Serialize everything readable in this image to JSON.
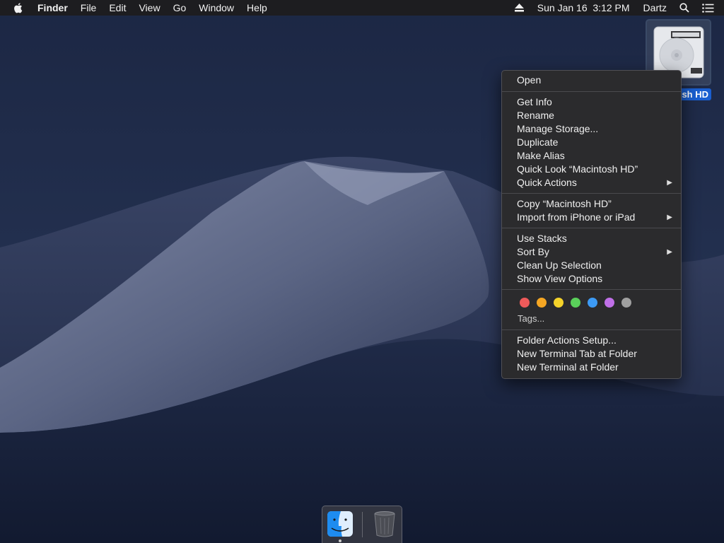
{
  "menubar": {
    "apple_icon": "apple-logo-icon",
    "app_name": "Finder",
    "menus": [
      "File",
      "Edit",
      "View",
      "Go",
      "Window",
      "Help"
    ],
    "status": {
      "eject_icon": "eject-icon",
      "clock": "Sun Jan 16  3:12 PM",
      "user": "Dartz",
      "search_icon": "spotlight-search-icon",
      "notification_icon": "notification-center-icon"
    }
  },
  "desktop": {
    "hd_icon_label": "sh HD",
    "hd_icon_name": "hard-drive-icon"
  },
  "context_menu": {
    "open": "Open",
    "group2": [
      "Get Info",
      "Rename",
      "Manage Storage...",
      "Duplicate",
      "Make Alias",
      "Quick Look “Macintosh HD”",
      "Quick Actions"
    ],
    "group3": [
      "Copy “Macintosh HD”",
      "Import from iPhone or iPad"
    ],
    "group4": [
      "Use Stacks",
      "Sort By",
      "Clean Up Selection",
      "Show View Options"
    ],
    "tags_label": "Tags...",
    "tag_colors": [
      "#ee5a5a",
      "#f5a623",
      "#f5d32a",
      "#5ad05a",
      "#3d9bf5",
      "#c070e8",
      "#a0a0a0"
    ],
    "group6": [
      "Folder Actions Setup...",
      "New Terminal Tab at Folder",
      "New Terminal at Folder"
    ],
    "submenu_arrow": "▶"
  },
  "dock": {
    "apps": [
      "finder-icon",
      "trash-icon"
    ]
  }
}
